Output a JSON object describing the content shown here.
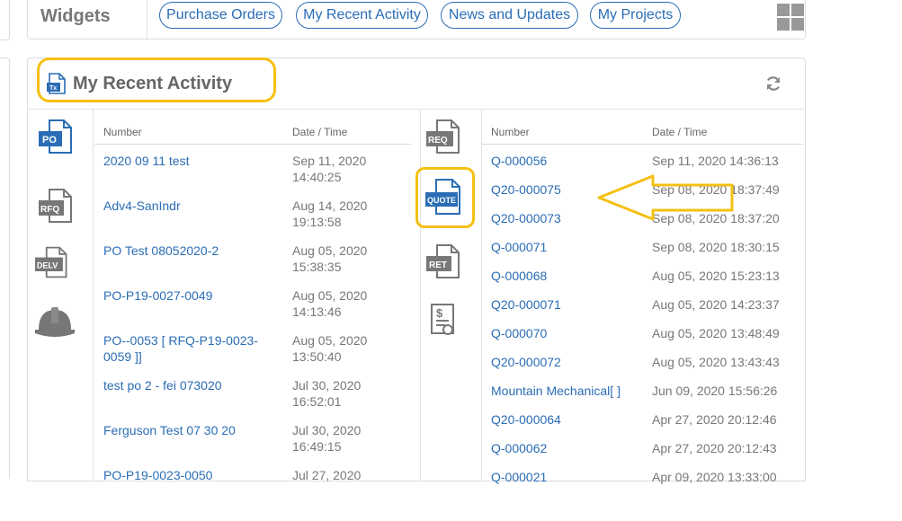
{
  "widgets": {
    "title": "Widgets",
    "pills": [
      "Purchase Orders",
      "My Recent Activity",
      "News and Updates",
      "My Projects"
    ]
  },
  "panel": {
    "title": "My Recent Activity"
  },
  "left_icons": [
    "PO",
    "RFQ",
    "DELV",
    "hardhat"
  ],
  "right_icons": [
    "REQ",
    "QUOTE",
    "RET",
    "contract"
  ],
  "left_list": {
    "col_number": "Number",
    "col_datetime": "Date / Time",
    "rows": [
      {
        "number": "2020 09 11 test",
        "date": "Sep 11, 2020",
        "time": "14:40:25"
      },
      {
        "number": "Adv4-SanIndr",
        "date": "Aug 14, 2020",
        "time": "19:13:58"
      },
      {
        "number": "PO Test 08052020-2",
        "date": "Aug 05, 2020",
        "time": "15:38:35"
      },
      {
        "number": "PO-P19-0027-0049",
        "date": "Aug 05, 2020",
        "time": "14:13:46"
      },
      {
        "number": "PO--0053 [ RFQ-P19-0023-",
        "number2": "0059 ]]",
        "date": "Aug 05, 2020",
        "time": "13:50:40"
      },
      {
        "number": "test po 2 - fei 073020",
        "date": "Jul 30, 2020",
        "time": "16:52:01"
      },
      {
        "number": "Ferguson Test 07 30 20",
        "date": "Jul 30, 2020",
        "time": "16:49:15"
      },
      {
        "number": "PO-P19-0023-0050",
        "date": "Jul 27, 2020",
        "time": ""
      }
    ]
  },
  "right_list": {
    "col_number": "Number",
    "col_datetime": "Date / Time",
    "rows": [
      {
        "number": "Q-000056",
        "datetime": "Sep 11, 2020 14:36:13"
      },
      {
        "number": "Q20-000075",
        "datetime": "Sep 08, 2020 18:37:49"
      },
      {
        "number": "Q20-000073",
        "datetime": "Sep 08, 2020 18:37:20"
      },
      {
        "number": "Q-000071",
        "datetime": "Sep 08, 2020 18:30:15"
      },
      {
        "number": "Q-000068",
        "datetime": "Aug 05, 2020 15:23:13"
      },
      {
        "number": "Q20-000071",
        "datetime": "Aug 05, 2020 14:23:37"
      },
      {
        "number": "Q-000070",
        "datetime": "Aug 05, 2020 13:48:49"
      },
      {
        "number": "Q20-000072",
        "datetime": "Aug 05, 2020 13:43:43"
      },
      {
        "number": "Mountain Mechanical[ ]",
        "datetime": "Jun 09, 2020 15:56:26"
      },
      {
        "number": "Q20-000064",
        "datetime": "Apr 27, 2020 20:12:46"
      },
      {
        "number": "Q-000062",
        "datetime": "Apr 27, 2020 20:12:43"
      },
      {
        "number": "Q-000021",
        "datetime": "Apr 09, 2020 13:33:00"
      }
    ]
  },
  "colors": {
    "accent": "#2a6db5",
    "highlight": "#f5c012"
  }
}
